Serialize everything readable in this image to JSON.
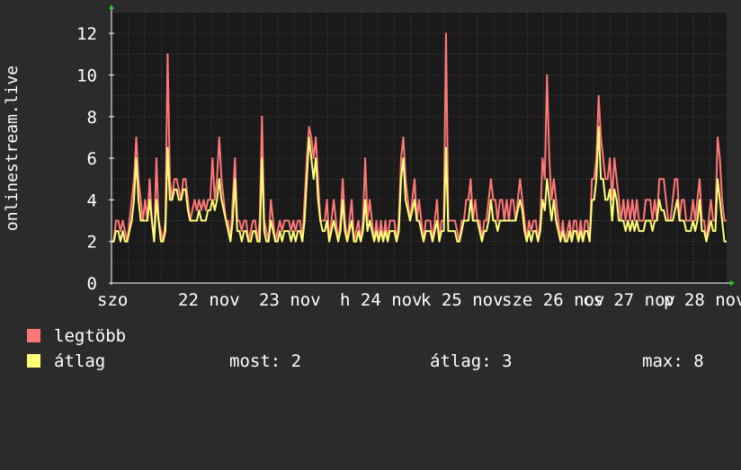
{
  "chart_data": {
    "type": "line",
    "ylabel": "onlinestream.live",
    "ylim": [
      0,
      13
    ],
    "y_ticks": [
      0,
      2,
      4,
      6,
      8,
      10,
      12
    ],
    "x_ticks": [
      "szo",
      "22 nov",
      "23 nov",
      "h 24 nov",
      "k 25 nov",
      "sze 26 nov",
      "cs 27 nov",
      "p 28 nov"
    ],
    "grid": true,
    "series": [
      {
        "name": "legtöbb",
        "color": "#ff7777",
        "values": [
          2,
          2,
          3,
          3,
          2.5,
          3,
          2.5,
          2,
          3,
          4,
          5,
          7,
          5,
          4,
          3,
          4,
          3,
          5,
          3,
          2,
          6,
          3,
          2.5,
          2,
          3,
          11,
          5,
          4,
          5,
          5,
          4.5,
          4,
          5,
          5,
          4,
          3,
          3.5,
          4,
          3.5,
          4,
          3.5,
          4,
          3.5,
          4,
          4,
          6,
          4,
          5,
          7,
          5,
          4,
          3,
          3,
          2,
          4,
          6,
          3,
          3,
          2.5,
          3,
          3,
          2,
          2.5,
          3,
          3,
          2,
          3,
          8,
          3,
          2.5,
          2,
          4,
          3,
          2,
          2.5,
          3,
          2.5,
          3,
          3,
          3,
          2.5,
          3,
          2.5,
          3,
          3,
          2,
          4,
          6,
          7.5,
          7,
          6,
          7,
          5,
          3,
          3,
          3,
          4,
          2,
          3,
          4,
          3,
          2,
          3,
          5,
          3,
          2,
          3,
          4,
          2,
          2.5,
          3,
          2,
          3,
          6,
          3,
          4,
          3,
          2,
          3,
          2,
          3,
          2,
          3,
          2,
          3,
          3,
          3,
          2,
          3,
          6,
          7,
          5,
          4,
          3,
          4,
          5,
          3,
          4,
          3,
          2,
          3,
          3,
          3,
          2,
          3,
          4,
          2,
          3,
          3,
          12,
          3,
          3,
          3,
          3,
          2.5,
          2,
          3,
          3,
          4,
          4,
          5,
          3,
          4,
          3,
          3,
          2,
          3,
          3,
          4,
          5,
          4,
          4,
          3,
          4,
          4,
          3,
          4,
          3,
          4,
          4,
          3,
          4,
          5,
          4,
          3,
          2,
          3,
          2.5,
          3,
          3,
          2,
          3,
          6,
          5,
          10,
          6,
          4,
          5,
          4,
          3,
          2,
          3,
          2,
          2.5,
          3,
          2,
          3,
          3,
          2,
          3,
          2,
          3,
          3,
          2,
          5,
          5,
          6,
          9,
          7,
          6,
          5,
          5,
          6,
          4,
          6,
          5,
          4,
          3,
          4,
          3,
          4,
          3,
          4,
          3,
          4,
          3,
          3,
          3,
          4,
          4,
          4,
          3,
          4,
          3,
          5,
          5,
          5,
          4,
          3,
          3,
          4,
          5,
          5,
          3,
          4,
          4,
          3,
          3,
          3,
          4,
          3,
          4,
          5,
          3,
          3,
          2,
          3,
          4,
          3,
          3,
          7,
          6,
          4,
          3,
          3
        ]
      },
      {
        "name": "átlag",
        "color": "#ffff77",
        "values": [
          2,
          2,
          2.5,
          2.5,
          2,
          2.5,
          2,
          2,
          2.5,
          3,
          4,
          6,
          4,
          3,
          3,
          3,
          3,
          4,
          3,
          2,
          4,
          3,
          2,
          2,
          2.5,
          6.5,
          4,
          4,
          4.5,
          4.5,
          4,
          4,
          4.5,
          4.5,
          3.5,
          3,
          3,
          3,
          3,
          3.5,
          3,
          3,
          3,
          3.5,
          3.5,
          4,
          3.5,
          4,
          5,
          4,
          3.5,
          3,
          2.5,
          2,
          3,
          5,
          2.5,
          2.5,
          2,
          2.5,
          2.5,
          2,
          2,
          2.5,
          2.5,
          2,
          2,
          6,
          2.5,
          2,
          2,
          3,
          2.5,
          2,
          2,
          2.5,
          2,
          2.5,
          2.5,
          2.5,
          2,
          2.5,
          2,
          2.5,
          2.5,
          2,
          3,
          5,
          7,
          6,
          5,
          6,
          4,
          3,
          2.5,
          2.5,
          3,
          2,
          2.5,
          3,
          2.5,
          2,
          2.5,
          4,
          2.5,
          2,
          2.5,
          3,
          2,
          2,
          2.5,
          2,
          2.5,
          4,
          2.5,
          3,
          2.5,
          2,
          2.5,
          2,
          2.5,
          2,
          2.5,
          2,
          2.5,
          2.5,
          2.5,
          2,
          2.5,
          5,
          6,
          4,
          3.5,
          3,
          3.5,
          4,
          3,
          3,
          2.5,
          2,
          2.5,
          2.5,
          2.5,
          2,
          2.5,
          3,
          2,
          2.5,
          2.5,
          6.5,
          2.5,
          2.5,
          2.5,
          2.5,
          2,
          2,
          2.5,
          3,
          3,
          3,
          4,
          3,
          3,
          3,
          2.5,
          2,
          2.5,
          2.5,
          3,
          4,
          3,
          3,
          2.5,
          3,
          3,
          3,
          3,
          3,
          3,
          3,
          3,
          3.5,
          4,
          3.5,
          2.5,
          2,
          2.5,
          2,
          2.5,
          2.5,
          2,
          2.5,
          4,
          3.5,
          5,
          4,
          3,
          4,
          3,
          2.5,
          2,
          2.5,
          2,
          2,
          2.5,
          2,
          2.5,
          2.5,
          2,
          2.5,
          2,
          2.5,
          2.5,
          2,
          4,
          4,
          5,
          7.5,
          5,
          5,
          4,
          4,
          4.5,
          3,
          4.5,
          4,
          3,
          3,
          3,
          2.5,
          3,
          2.5,
          3,
          2.5,
          3,
          2.5,
          2.5,
          2.5,
          3,
          3,
          3,
          2.5,
          3,
          3,
          4,
          3.5,
          3.5,
          3,
          3,
          3,
          3,
          3.5,
          4,
          3,
          3,
          3,
          2.5,
          2.5,
          2.5,
          3,
          2.5,
          3,
          4,
          2.5,
          2.5,
          2,
          2.5,
          3,
          2.5,
          2.5,
          5,
          4,
          3,
          2,
          2
        ]
      }
    ]
  },
  "legend": {
    "items": [
      {
        "label": "legtöbb",
        "color": "#ff7777"
      },
      {
        "label": "átlag",
        "color": "#ffff77"
      }
    ],
    "stats": {
      "now": "most: 2",
      "avg": "átlag: 3",
      "max": "max: 8"
    }
  }
}
